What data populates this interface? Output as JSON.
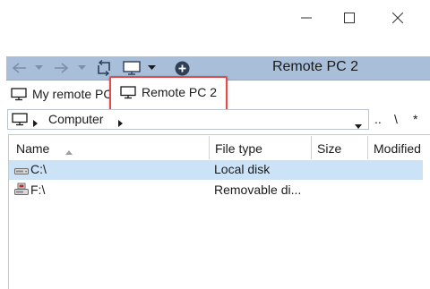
{
  "toolbar": {
    "title": "Remote PC 2"
  },
  "tabs": [
    {
      "label": "My remote PC"
    },
    {
      "label": "Remote PC 2"
    }
  ],
  "address": {
    "location": "Computer",
    "nav_dotdot": "..",
    "nav_backslash": "\\",
    "nav_star": "*"
  },
  "list": {
    "columns": [
      "Name",
      "File type",
      "Size",
      "Modified"
    ],
    "rows": [
      {
        "name": "C:\\",
        "type": "Local disk",
        "size": "",
        "modified": "",
        "selected": true
      },
      {
        "name": "F:\\",
        "type": "Removable di...",
        "size": "",
        "modified": "",
        "selected": false
      }
    ]
  },
  "colors": {
    "toolbar_bg": "#a9bfd9",
    "selection": "#cce3f7",
    "highlight_border": "#e24b4b"
  }
}
